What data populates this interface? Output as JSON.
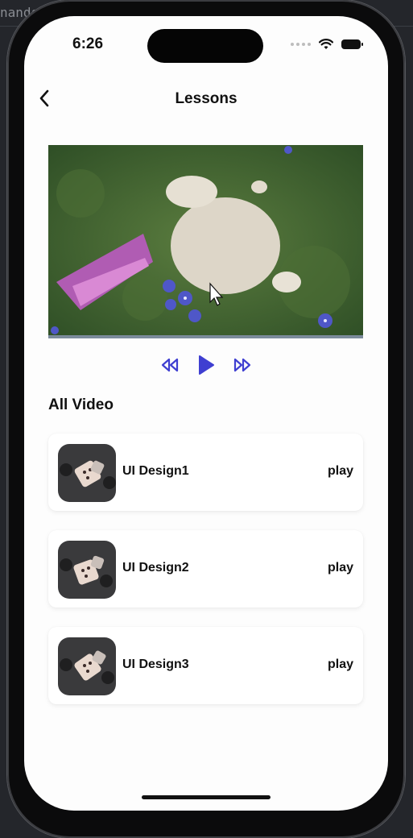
{
  "background": {
    "fragment_top": "nands"
  },
  "status_bar": {
    "time": "6:26"
  },
  "header": {
    "title": "Lessons",
    "back_icon": "chevron-left-icon"
  },
  "player": {
    "controls": [
      "rewind-icon",
      "play-icon",
      "fast-forward-icon"
    ],
    "accent_color": "#3f3fd1"
  },
  "section": {
    "title": "All Video"
  },
  "videos": [
    {
      "title": "UI Design1",
      "action": "play"
    },
    {
      "title": "UI Design2",
      "action": "play"
    },
    {
      "title": "UI Design3",
      "action": "play"
    }
  ]
}
